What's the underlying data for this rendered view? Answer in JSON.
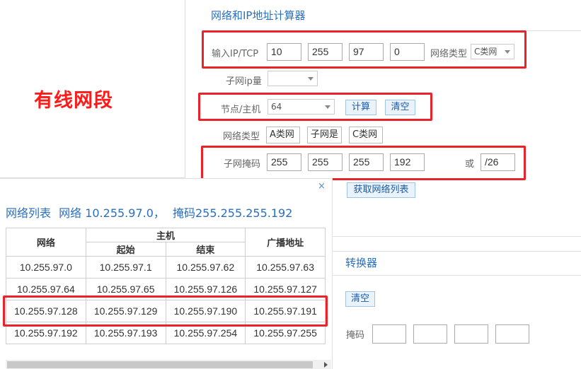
{
  "annotation": "有线网段",
  "calc": {
    "title": "网络和IP地址计算器",
    "ip_label": "输入IP/TCP",
    "ip": [
      "10",
      "255",
      "97",
      "0"
    ],
    "net_type_label": "网络类型",
    "net_type_value": "C类网",
    "subnet_count_label": "子网ip量",
    "host_label": "节点/主机",
    "host_value": "64",
    "calc_button": "计算",
    "clear_button": "清空",
    "class_label": "网络类型",
    "class_tags": [
      "A类网",
      "子网是",
      "C类网"
    ],
    "mask_label": "子网掩码",
    "mask": [
      "255",
      "255",
      "255",
      "192"
    ],
    "or_label": "或",
    "prefix": "/26",
    "fetch_button": "获取网络列表"
  },
  "converter": {
    "title_partial": "转换器",
    "clear_button": "清空",
    "mask_label_partial": "掩码"
  },
  "popup": {
    "close": "×",
    "title_prefix": "网络列表",
    "title_net": "网络 10.255.97.0，",
    "title_mask": "掩码255.255.255.192",
    "headers": {
      "network": "网络",
      "host": "主机",
      "start": "起始",
      "end": "结束",
      "broadcast": "广播地址"
    },
    "rows": [
      [
        "10.255.97.0",
        "10.255.97.1",
        "10.255.97.62",
        "10.255.97.63"
      ],
      [
        "10.255.97.64",
        "10.255.97.65",
        "10.255.97.126",
        "10.255.97.127"
      ],
      [
        "10.255.97.128",
        "10.255.97.129",
        "10.255.97.190",
        "10.255.97.191"
      ],
      [
        "10.255.97.192",
        "10.255.97.193",
        "10.255.97.254",
        "10.255.97.255"
      ]
    ]
  },
  "colors": {
    "accent_blue": "#2a6fc0",
    "annotation_red": "#e8242a"
  }
}
